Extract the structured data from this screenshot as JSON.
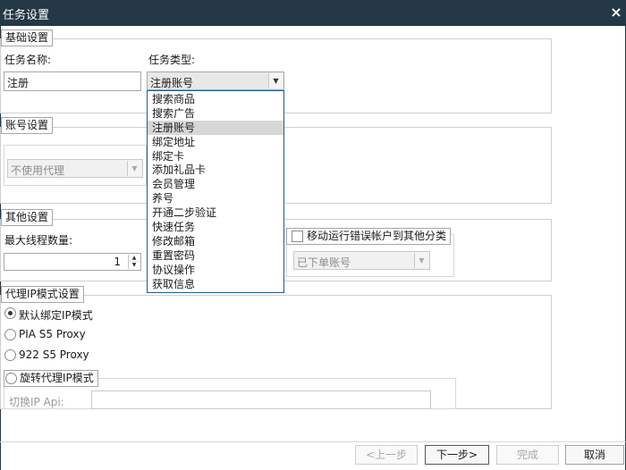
{
  "window": {
    "title": "任务设置",
    "close_glyph": "×"
  },
  "basic": {
    "legend": "基础设置",
    "task_name_label": "任务名称:",
    "task_name_value": "注册",
    "task_type_label": "任务类型:",
    "task_type_value": "注册账号"
  },
  "task_type_options": [
    "搜索商品",
    "搜索广告",
    "注册账号",
    "绑定地址",
    "绑定卡",
    "添加礼品卡",
    "会员管理",
    "养号",
    "开通二步验证",
    "快速任务",
    "修改邮箱",
    "重置密码",
    "协议操作",
    "获取信息"
  ],
  "task_type_selected_index": 2,
  "account": {
    "legend": "账号设置",
    "proxy_combo_value": "不使用代理"
  },
  "other": {
    "legend": "其他设置",
    "max_threads_label": "最大线程数量:",
    "max_threads_value": "1",
    "move_errors_label": "移动运行错误帐户到其他分类",
    "move_errors_checked": false,
    "category_combo_value": "已下单账号"
  },
  "proxy_mode": {
    "legend": "代理IP模式设置",
    "options": [
      {
        "label": "默认绑定IP模式",
        "checked": true
      },
      {
        "label": "PIA S5 Proxy",
        "checked": false
      },
      {
        "label": "922 S5 Proxy",
        "checked": false
      },
      {
        "label": "旋转代理IP模式",
        "checked": false
      }
    ],
    "switch_api_label": "切换IP Api:",
    "switch_api_value": ""
  },
  "footer": {
    "prev_label": "<上一步",
    "next_label": "下一步>",
    "finish_label": "完成",
    "cancel_label": "取消"
  },
  "icons": {
    "combo_arrow": "chevron-down-icon",
    "spin_up": "chevron-up-icon",
    "spin_down": "chevron-down-icon",
    "close": "close-icon"
  },
  "colors": {
    "titlebar": "#253846",
    "dropdown_border": "#1f5c8a",
    "selected_item": "#d7d7d7"
  }
}
